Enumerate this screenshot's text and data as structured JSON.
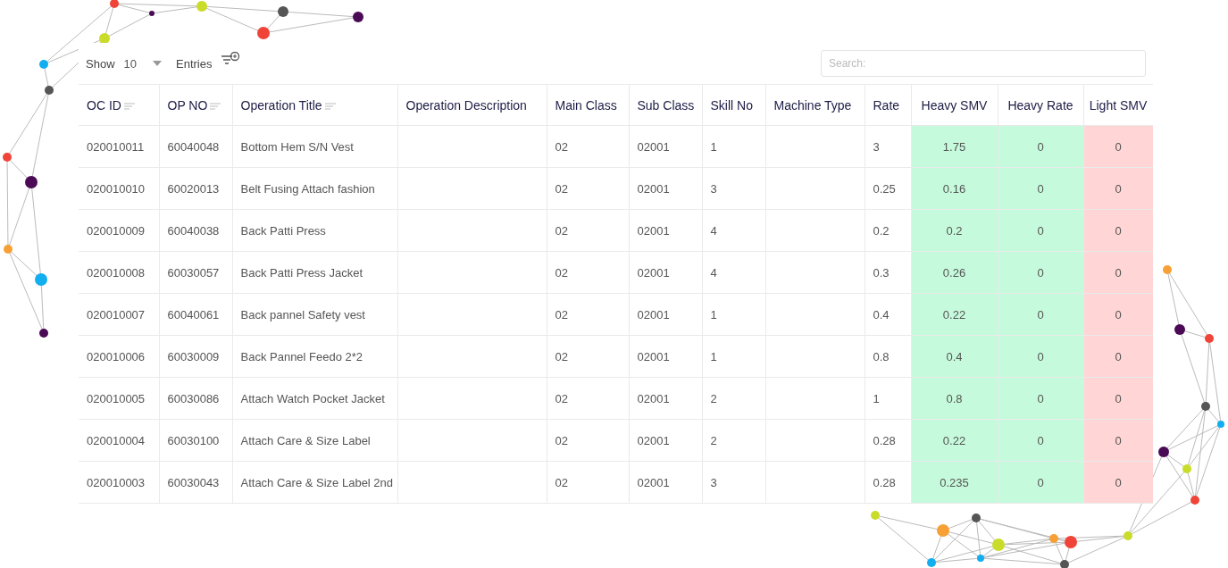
{
  "toolbar": {
    "show_label": "Show",
    "page_size": "10",
    "entries_label": "Entries",
    "search": {
      "placeholder": "Search:"
    }
  },
  "table": {
    "columns": [
      {
        "label": "OC ID",
        "sortable": true
      },
      {
        "label": "OP NO",
        "sortable": true
      },
      {
        "label": "Operation Title",
        "sortable": true
      },
      {
        "label": "Operation Description",
        "sortable": false
      },
      {
        "label": "Main Class",
        "sortable": false
      },
      {
        "label": "Sub Class",
        "sortable": false
      },
      {
        "label": "Skill No",
        "sortable": false
      },
      {
        "label": "Machine Type",
        "sortable": false
      },
      {
        "label": "Rate",
        "sortable": false
      },
      {
        "label": "Heavy SMV",
        "sortable": false,
        "color": "#c6fadc"
      },
      {
        "label": "Heavy Rate",
        "sortable": false,
        "color": "#c6fadc"
      },
      {
        "label": "Light SMV",
        "sortable": false,
        "color": "#ffd5d5"
      }
    ],
    "rows": [
      [
        "020010011",
        "60040048",
        "Bottom Hem S/N Vest",
        "",
        "02",
        "02001",
        "1",
        "",
        "3",
        "1.75",
        "0",
        "0"
      ],
      [
        "020010010",
        "60020013",
        "Belt Fusing Attach fashion",
        "",
        "02",
        "02001",
        "3",
        "",
        "0.25",
        "0.16",
        "0",
        "0"
      ],
      [
        "020010009",
        "60040038",
        "Back Patti Press",
        "",
        "02",
        "02001",
        "4",
        "",
        "0.2",
        "0.2",
        "0",
        "0"
      ],
      [
        "020010008",
        "60030057",
        "Back Patti Press Jacket",
        "",
        "02",
        "02001",
        "4",
        "",
        "0.3",
        "0.26",
        "0",
        "0"
      ],
      [
        "020010007",
        "60040061",
        "Back pannel Safety vest",
        "",
        "02",
        "02001",
        "1",
        "",
        "0.4",
        "0.22",
        "0",
        "0"
      ],
      [
        "020010006",
        "60030009",
        "Back Pannel Feedo 2*2",
        "",
        "02",
        "02001",
        "1",
        "",
        "0.8",
        "0.4",
        "0",
        "0"
      ],
      [
        "020010005",
        "60030086",
        "Attach Watch Pocket Jacket",
        "",
        "02",
        "02001",
        "2",
        "",
        "1",
        "0.8",
        "0",
        "0"
      ],
      [
        "020010004",
        "60030100",
        "Attach Care & Size Label",
        "",
        "02",
        "02001",
        "2",
        "",
        "0.28",
        "0.22",
        "0",
        "0"
      ],
      [
        "020010003",
        "60030043",
        "Attach Care & Size Label 2nd",
        "",
        "02",
        "02001",
        "3",
        "",
        "0.28",
        "0.235",
        "0",
        "0"
      ]
    ]
  }
}
